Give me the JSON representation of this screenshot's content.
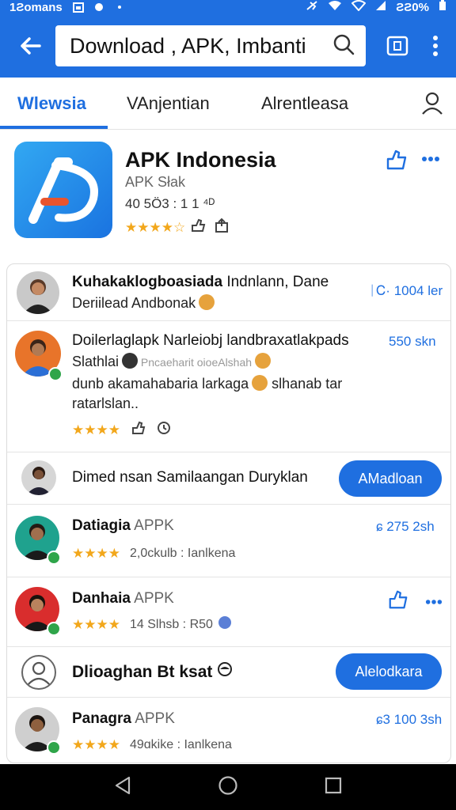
{
  "status_bar": {
    "time": "1Ƨomans",
    "battery": "ƧƧ0%"
  },
  "search": {
    "value": "Download , APK, Imbanti"
  },
  "tabs": [
    {
      "label": "Wlewsia"
    },
    {
      "label": "VAnjentian"
    },
    {
      "label": "Alrentleasa"
    }
  ],
  "app": {
    "title": "APK Indonesia",
    "subtitle": "APK Słak",
    "meta": "40 5Ö3 : 1   1 ⁴ᴰ",
    "stars": "★★★★☆"
  },
  "rows": [
    {
      "title": "Kuhakaklogboasiada",
      "title_rest": " Indnlann, Dane",
      "line2": "Deriilead Andbonak",
      "right": "ᛁᏟ· 1004 ler"
    },
    {
      "title": "Doilerlaglapk Narleiobj landbraxatlakpads",
      "line2": "Slathlai",
      "line2_rest": " Pncaeharit oioeAlshah",
      "line3": "dunb akamahabaria larkaga",
      "line3_rest": " slhanab tar",
      "line4": "ratarlslan..",
      "right": "550 skn",
      "stars": "★★★★"
    },
    {
      "title": "Dimed nsan Samilaangan Duryklan",
      "button": "AMadloan"
    },
    {
      "title": "Datiagia",
      "title_dim": " APPK",
      "right": "ɕ 275 2sh",
      "stars": "★★★★",
      "meta": "2,0ckulb :   Ianlkena"
    },
    {
      "title": "Danhaia",
      "title_dim": " APPK",
      "stars": "★★★★",
      "meta": "14 Slhsb :   R50"
    },
    {
      "title": "Dlioaghan Bt ksat",
      "button": "Alelodkara"
    },
    {
      "title": "Panagra",
      "title_dim": " APPK",
      "right": "ɕ3 100 3sh",
      "stars": "★★★★",
      "meta": "49ɑkike :   Ianlkena"
    }
  ],
  "colors": {
    "accent": "#1f6fe0",
    "star": "#f2a71b",
    "badge": "#2fa54a"
  }
}
